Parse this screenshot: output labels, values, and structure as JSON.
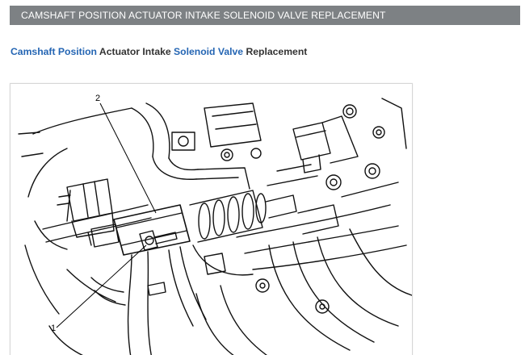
{
  "header": {
    "title": "CAMSHAFT POSITION ACTUATOR INTAKE SOLENOID VALVE REPLACEMENT"
  },
  "subtitle": {
    "link1": "Camshaft Position",
    "text1": " Actuator Intake ",
    "link2": "Solenoid Valve",
    "text2": " Replacement"
  },
  "figure": {
    "callouts": [
      "1",
      "2"
    ]
  },
  "colors": {
    "header_bg": "#7d8184",
    "link": "#2465b3",
    "text": "#333333"
  }
}
